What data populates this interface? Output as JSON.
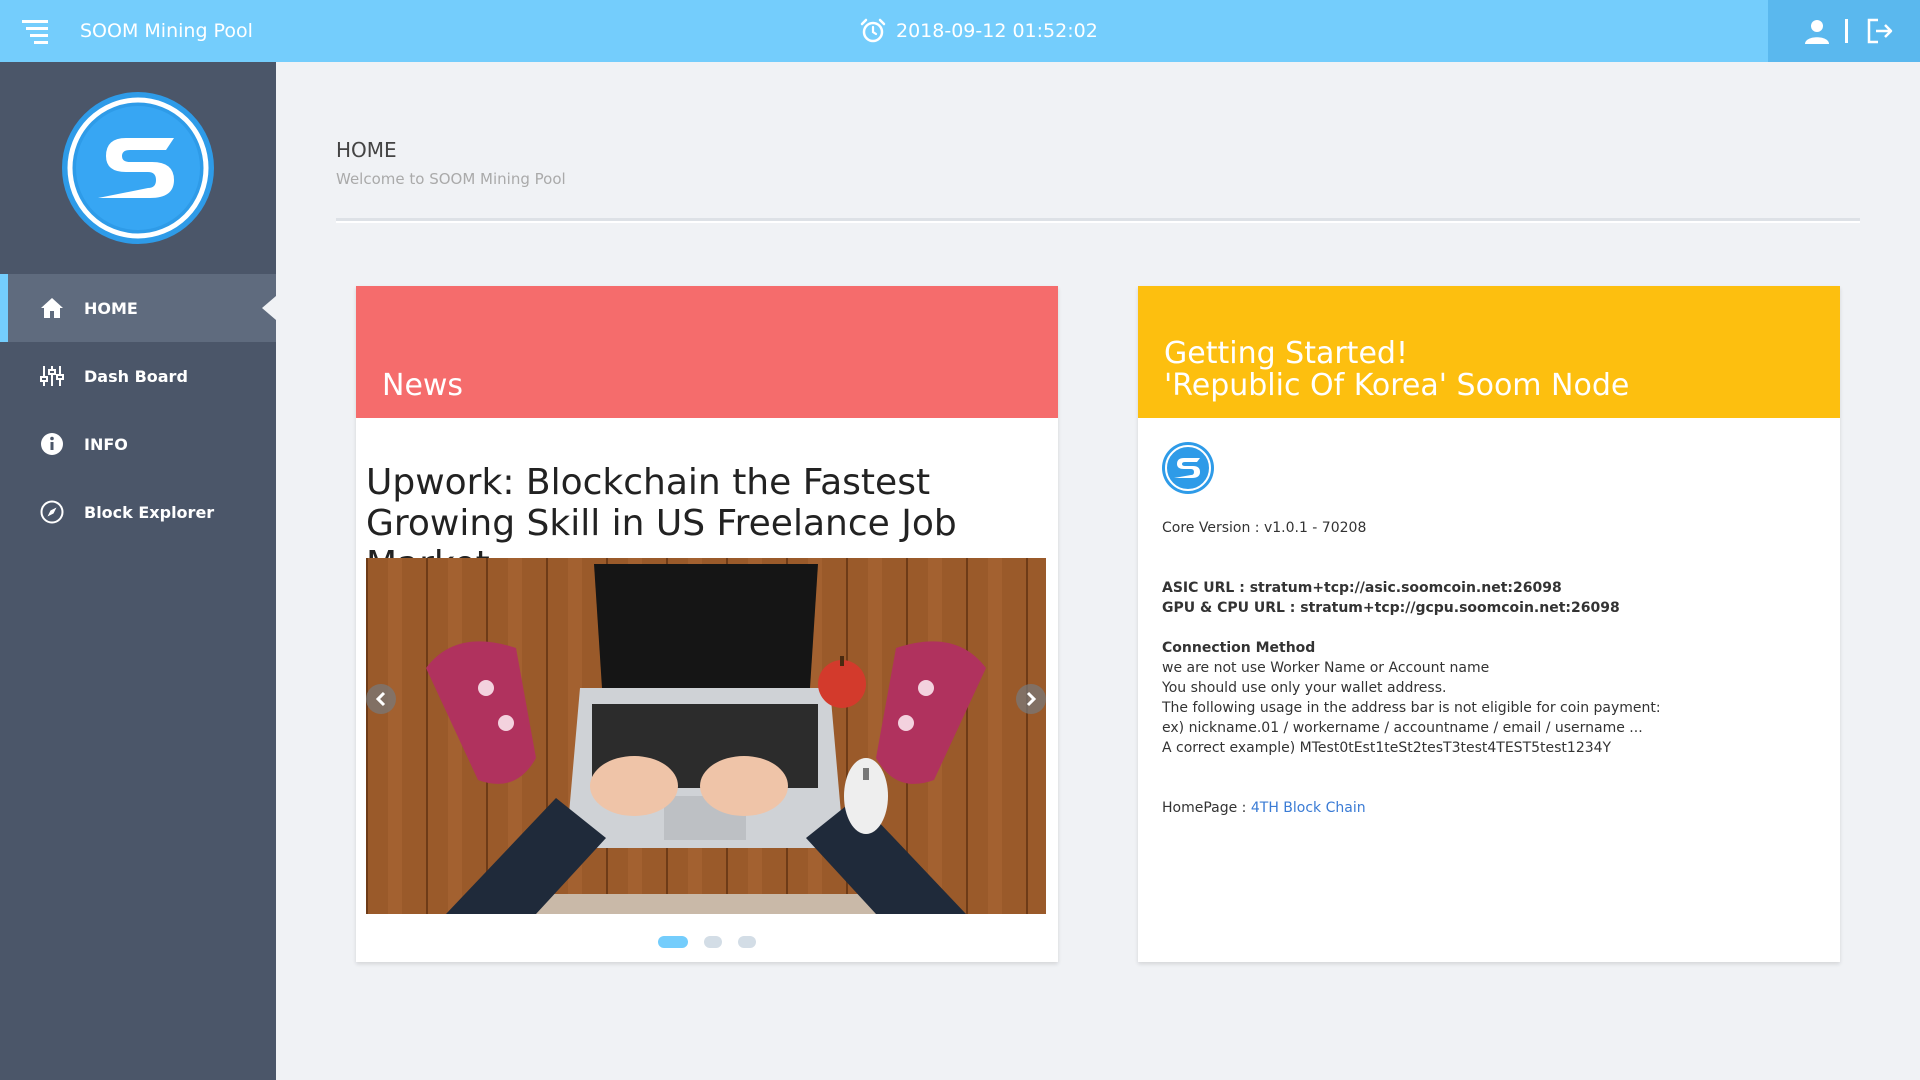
{
  "topbar": {
    "brand": "SOOM Mining Pool",
    "datetime": "2018-09-12 01:52:02"
  },
  "sidebar": {
    "items": [
      {
        "label": "HOME",
        "icon": "home-icon"
      },
      {
        "label": "Dash Board",
        "icon": "sliders-icon"
      },
      {
        "label": "INFO",
        "icon": "info-icon"
      },
      {
        "label": "Block Explorer",
        "icon": "compass-icon"
      }
    ]
  },
  "page": {
    "title": "HOME",
    "subtitle": "Welcome to SOOM Mining Pool"
  },
  "news": {
    "header": "News",
    "headline": "Upwork: Blockchain the Fastest Growing Skill in US Freelance Job Market",
    "slide_count": 3,
    "active_slide": 1
  },
  "getting_started": {
    "header_line1": "Getting Started!",
    "header_line2": "'Republic Of Korea' Soom Node",
    "core_version": "Core Version : v1.0.1 - 70208",
    "asic_url": "ASIC URL : stratum+tcp://asic.soomcoin.net:26098",
    "gpu_url": "GPU & CPU URL : stratum+tcp://gcpu.soomcoin.net:26098",
    "connection_title": "Connection Method",
    "line1": "we are not use Worker Name or Account name",
    "line2": "You should use only your wallet address.",
    "line3": "The following usage in the address bar is not eligible for coin payment:",
    "line4": "ex) nickname.01 / workername / accountname / email / username ...",
    "line5": "A correct example) MTest0tEst1teSt2tesT3test4TEST5test1234Y",
    "homepage_label": "HomePage : ",
    "homepage_link": "4TH Block Chain"
  },
  "colors": {
    "topbar": "#74cdfc",
    "sidebar": "#4b5669",
    "news": "#f56c6c",
    "start": "#fdbf0f",
    "link": "#3a7bd5"
  }
}
